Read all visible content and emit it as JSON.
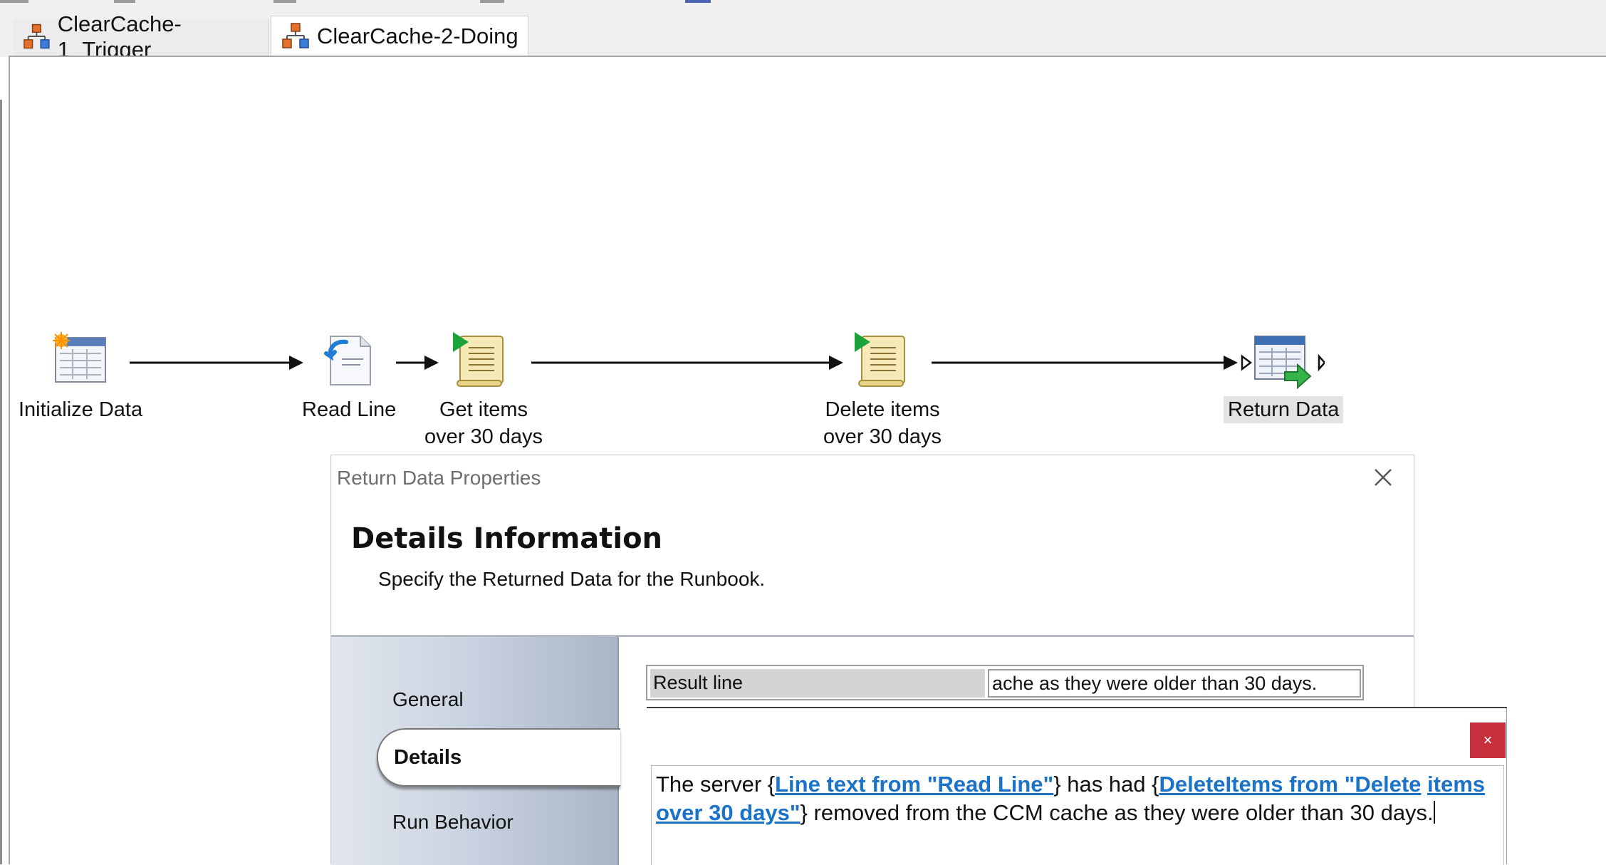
{
  "tabs": [
    {
      "label": "ClearCache-1_Trigger",
      "icon": "runbook-icon",
      "active": false
    },
    {
      "label": "ClearCache-2-Doing",
      "icon": "runbook-icon",
      "active": true
    }
  ],
  "workflow": {
    "activities": [
      {
        "label": "Initialize Data",
        "icon": "initialize-data-icon"
      },
      {
        "label": "Read Line",
        "icon": "read-line-icon"
      },
      {
        "label_line1": "Get items",
        "label_line2": "over 30 days",
        "icon": "script-icon"
      },
      {
        "label_line1": "Delete items",
        "label_line2": "over 30 days",
        "icon": "script-icon"
      },
      {
        "label": "Return Data",
        "icon": "return-data-icon",
        "selected": true
      }
    ]
  },
  "dialog": {
    "title": "Return Data Properties",
    "heading": "Details Information",
    "subheading": "Specify the Returned Data for the Runbook.",
    "nav": {
      "general": "General",
      "details": "Details",
      "run_behavior": "Run Behavior"
    },
    "table": {
      "header": "Result line",
      "value": "ache as they were older than 30 days."
    }
  },
  "editor": {
    "close_label": "×",
    "text_1": "The server {",
    "link_1": "Line text from \"Read Line\"",
    "text_2": "} has had {",
    "link_2a": "DeleteItems from \"Delete",
    "link_2b": "items over 30 days\"",
    "text_3": "} removed from the CCM cache as they were older than 30",
    "text_4": "days."
  },
  "colors": {
    "link": "#1a73c9",
    "close_button": "#c62f3b",
    "nav_panel": "#cbd4e1"
  }
}
